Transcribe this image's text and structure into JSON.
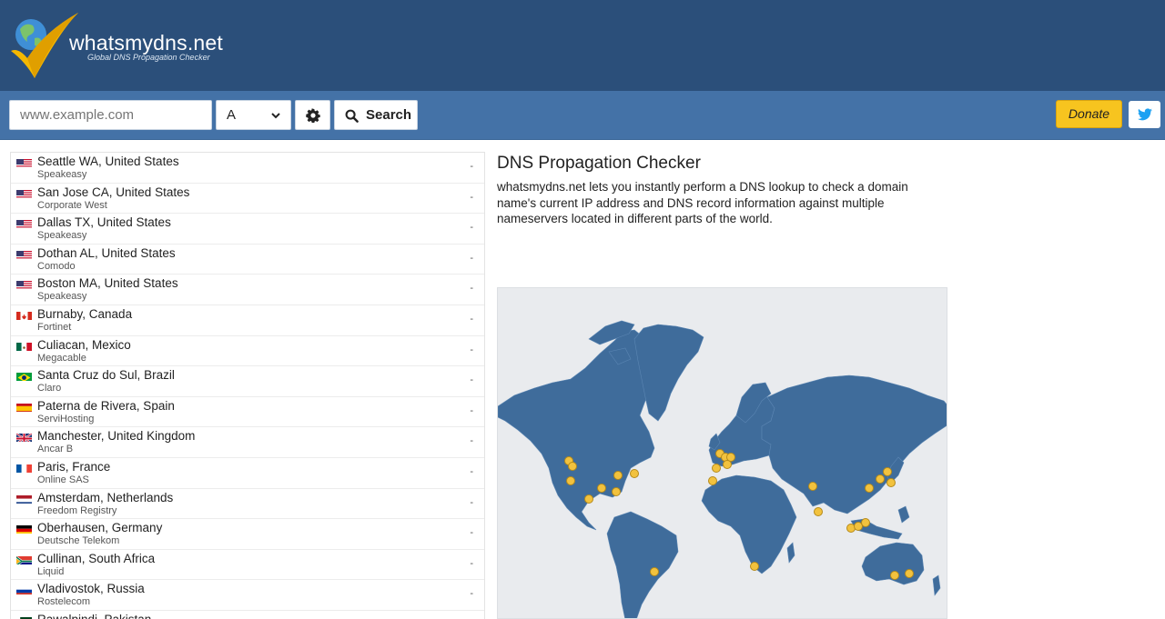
{
  "header": {
    "site_name": "whatsmydns.net",
    "tagline": "Global DNS Propagation Checker"
  },
  "toolbar": {
    "domain_placeholder": "www.example.com",
    "record_type": "A",
    "search_label": "Search",
    "donate_label": "Donate"
  },
  "icons": {
    "settings": "gear-icon",
    "search": "search-icon",
    "twitter": "twitter-icon",
    "dropdown": "chevron-down-icon"
  },
  "colors": {
    "header_bg": "#2b4f7a",
    "toolbar_bg": "#4472a7",
    "donate": "#f7c41f",
    "map_land": "#3f6c9b",
    "map_marker": "#f2c23e"
  },
  "results": [
    {
      "flag": "us",
      "location": "Seattle WA, United States",
      "provider": "Speakeasy",
      "result": "-"
    },
    {
      "flag": "us",
      "location": "San Jose CA, United States",
      "provider": "Corporate West",
      "result": "-"
    },
    {
      "flag": "us",
      "location": "Dallas TX, United States",
      "provider": "Speakeasy",
      "result": "-"
    },
    {
      "flag": "us",
      "location": "Dothan AL, United States",
      "provider": "Comodo",
      "result": "-"
    },
    {
      "flag": "us",
      "location": "Boston MA, United States",
      "provider": "Speakeasy",
      "result": "-"
    },
    {
      "flag": "ca",
      "location": "Burnaby, Canada",
      "provider": "Fortinet",
      "result": "-"
    },
    {
      "flag": "mx",
      "location": "Culiacan, Mexico",
      "provider": "Megacable",
      "result": "-"
    },
    {
      "flag": "br",
      "location": "Santa Cruz do Sul, Brazil",
      "provider": "Claro",
      "result": "-"
    },
    {
      "flag": "es",
      "location": "Paterna de Rivera, Spain",
      "provider": "ServiHosting",
      "result": "-"
    },
    {
      "flag": "gb",
      "location": "Manchester, United Kingdom",
      "provider": "Ancar B",
      "result": "-"
    },
    {
      "flag": "fr",
      "location": "Paris, France",
      "provider": "Online SAS",
      "result": "-"
    },
    {
      "flag": "nl",
      "location": "Amsterdam, Netherlands",
      "provider": "Freedom Registry",
      "result": "-"
    },
    {
      "flag": "de",
      "location": "Oberhausen, Germany",
      "provider": "Deutsche Telekom",
      "result": "-"
    },
    {
      "flag": "za",
      "location": "Cullinan, South Africa",
      "provider": "Liquid",
      "result": "-"
    },
    {
      "flag": "ru",
      "location": "Vladivostok, Russia",
      "provider": "Rostelecom",
      "result": "-"
    },
    {
      "flag": "pk",
      "location": "Rawalpindi, Pakistan",
      "provider": "",
      "result": ""
    }
  ],
  "main": {
    "title": "DNS Propagation Checker",
    "intro": "whatsmydns.net lets you instantly perform a DNS lookup to check a domain name's current IP address and DNS record information against multiple nameservers located in different parts of the world."
  }
}
